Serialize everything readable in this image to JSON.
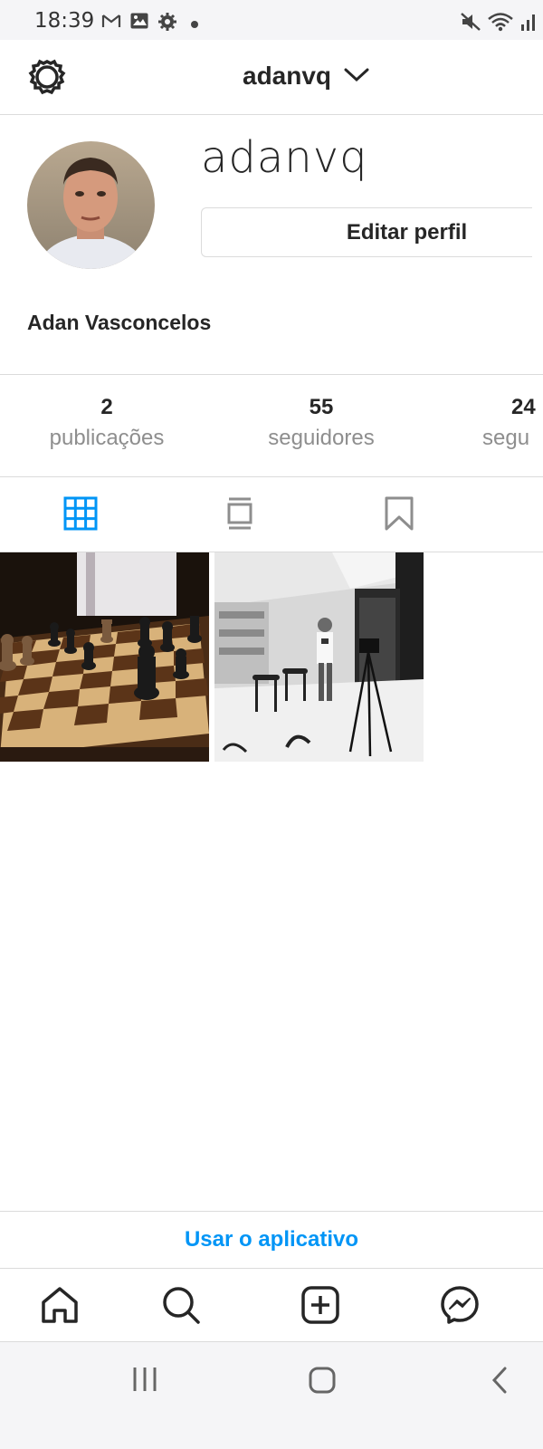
{
  "status_bar": {
    "time": "18:39",
    "icons": [
      "gmail-icon",
      "gallery-icon",
      "settings-icon",
      "dot-icon",
      "mute-icon",
      "wifi-icon",
      "signal-icon"
    ]
  },
  "header": {
    "username": "adanvq",
    "settings_icon": "gear-icon",
    "dropdown_icon": "chevron-down-icon"
  },
  "profile": {
    "username": "adanvq",
    "edit_button": "Editar perfil",
    "full_name": "Adan Vasconcelos"
  },
  "stats": [
    {
      "count": "2",
      "label": "publicações"
    },
    {
      "count": "55",
      "label": "seguidores"
    },
    {
      "count": "24",
      "label": "segu"
    }
  ],
  "tabs": [
    {
      "name": "grid",
      "icon": "grid-icon",
      "active": true
    },
    {
      "name": "guides",
      "icon": "guide-icon",
      "active": false
    },
    {
      "name": "saved",
      "icon": "bookmark-icon",
      "active": false
    }
  ],
  "posts": [
    {
      "subject": "chess-board-photo"
    },
    {
      "subject": "man-in-store-photo"
    }
  ],
  "banner": {
    "text": "Usar o aplicativo"
  },
  "bottom_nav": [
    "home-icon",
    "search-icon",
    "new-post-icon",
    "messenger-icon"
  ],
  "system_nav": [
    "recents-icon",
    "home-icon",
    "back-icon"
  ],
  "colors": {
    "accent": "#0095f6",
    "text": "#262626",
    "muted": "#8e8e8e",
    "border": "#dbdbdb"
  }
}
